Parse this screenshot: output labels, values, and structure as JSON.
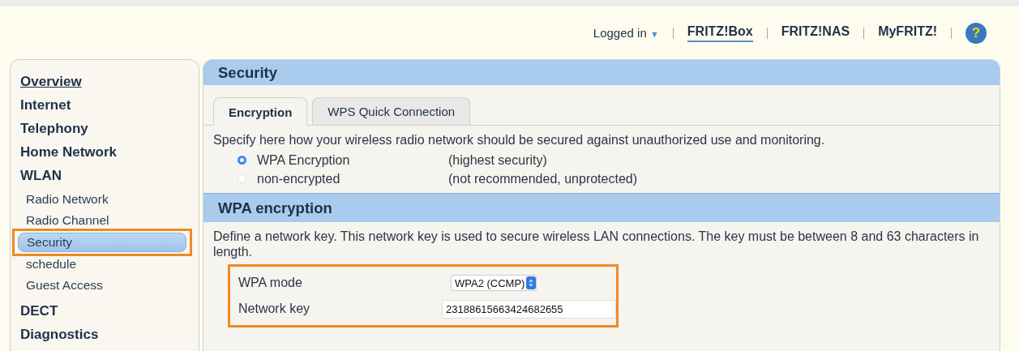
{
  "header": {
    "user_menu": {
      "label": "Logged in",
      "caret": "▼"
    },
    "links": [
      {
        "label": "FRITZ!Box",
        "selected": true
      },
      {
        "label": "FRITZ!NAS",
        "selected": false
      },
      {
        "label": "MyFRITZ!",
        "selected": false
      }
    ],
    "help": "?"
  },
  "sidebar": {
    "items": [
      {
        "label": "Overview",
        "underlined": true,
        "selected": false,
        "highlighted": false
      },
      {
        "label": "Internet",
        "underlined": false,
        "selected": false,
        "highlighted": false
      },
      {
        "label": "Telephony",
        "underlined": false,
        "selected": false,
        "highlighted": false
      },
      {
        "label": "Home Network",
        "underlined": false,
        "selected": false,
        "highlighted": false
      },
      {
        "label": "WLAN",
        "underlined": false,
        "selected": false,
        "highlighted": false,
        "children": [
          {
            "label": "Radio Network",
            "underlined": false,
            "selected": false,
            "highlighted": false
          },
          {
            "label": "Radio Channel",
            "underlined": false,
            "selected": false,
            "highlighted": false
          },
          {
            "label": "Security",
            "underlined": false,
            "selected": true,
            "highlighted": true
          },
          {
            "label": "schedule",
            "underlined": false,
            "selected": false,
            "highlighted": false
          },
          {
            "label": "Guest Access",
            "underlined": false,
            "selected": false,
            "highlighted": false
          }
        ]
      },
      {
        "label": "DECT",
        "underlined": false,
        "selected": false,
        "highlighted": false
      },
      {
        "label": "Diagnostics",
        "underlined": false,
        "selected": false,
        "highlighted": false
      }
    ]
  },
  "panel": {
    "title": "Security",
    "tabs": [
      {
        "label": "Encryption",
        "selected": true
      },
      {
        "label": "WPS Quick Connection",
        "selected": false
      }
    ],
    "intro": "Specify here how your wireless radio network should be secured against unauthorized use and monitoring.",
    "options": [
      {
        "label": "WPA Encryption",
        "note": "(highest security)",
        "selected": true
      },
      {
        "label": "non-encrypted",
        "note": "(not recommended, unprotected)",
        "selected": false
      }
    ],
    "section": {
      "title": "WPA encryption",
      "text": "Define a network key. This network key is used to secure wireless LAN connections. The key must be between 8 and 63 characters in length.",
      "highlighted": true,
      "fields": [
        {
          "label": "WPA mode",
          "kind": "select",
          "value": "WPA2 (CCMP)"
        },
        {
          "label": "Network key",
          "kind": "text",
          "value": "23188615663424682655"
        }
      ]
    }
  }
}
